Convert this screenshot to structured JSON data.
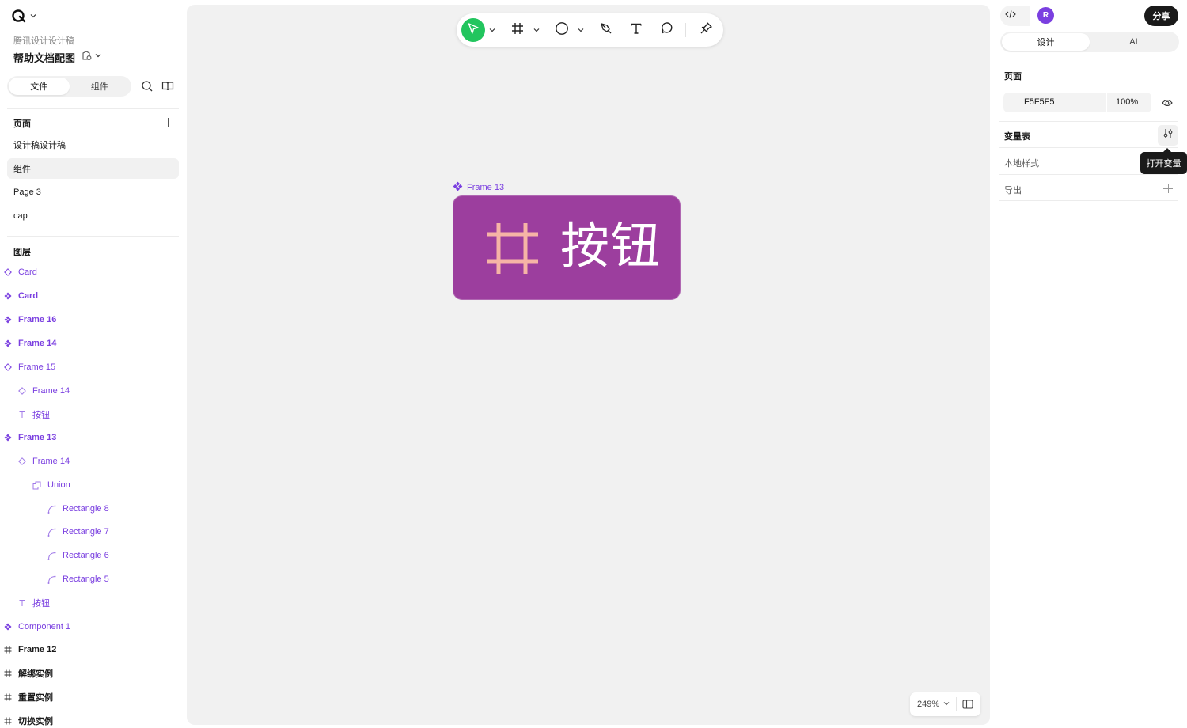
{
  "app": {
    "team_name": "腾讯设计设计稿",
    "file_title": "帮助文档配图"
  },
  "left_tabs": {
    "files": "文件",
    "components": "组件"
  },
  "pages": {
    "header": "页面",
    "items": [
      {
        "label": "设计稿设计稿"
      },
      {
        "label": "组件"
      },
      {
        "label": "Page 3"
      },
      {
        "label": "cap"
      }
    ]
  },
  "layers": {
    "header": "图层",
    "items": [
      {
        "label": "Card"
      },
      {
        "label": "Card"
      },
      {
        "label": "Frame 16"
      },
      {
        "label": "Frame 14"
      },
      {
        "label": "Frame 15"
      },
      {
        "label": "Frame 14"
      },
      {
        "label": "按钮"
      },
      {
        "label": "Frame 13"
      },
      {
        "label": "Frame 14"
      },
      {
        "label": "Union"
      },
      {
        "label": "Rectangle 8"
      },
      {
        "label": "Rectangle 7"
      },
      {
        "label": "Rectangle 6"
      },
      {
        "label": "Rectangle 5"
      },
      {
        "label": "按钮"
      },
      {
        "label": "Component 1"
      },
      {
        "label": "Frame 12"
      },
      {
        "label": "解绑实例"
      },
      {
        "label": "重置实例"
      },
      {
        "label": "切换实例"
      }
    ]
  },
  "canvas": {
    "frame_label": "Frame 13",
    "button_text": "按钮",
    "frame_color": "#9C3E9E",
    "grid_color": "#F6B4A6",
    "zoom": "249%"
  },
  "right_panel": {
    "avatar_initial": "R",
    "share_label": "分享",
    "tabs": {
      "design": "设计",
      "ai": "AI"
    },
    "page_section": {
      "label": "页面",
      "color_hex": "F5F5F5",
      "opacity": "100%"
    },
    "variables_label": "变量表",
    "open_variables_tooltip": "打开变量",
    "local_styles_label": "本地样式",
    "export_label": "导出"
  },
  "colors": {
    "accent_purple": "#7A3FE0",
    "tool_active_green": "#22C55E",
    "canvas_bg": "#F1F1F1"
  }
}
